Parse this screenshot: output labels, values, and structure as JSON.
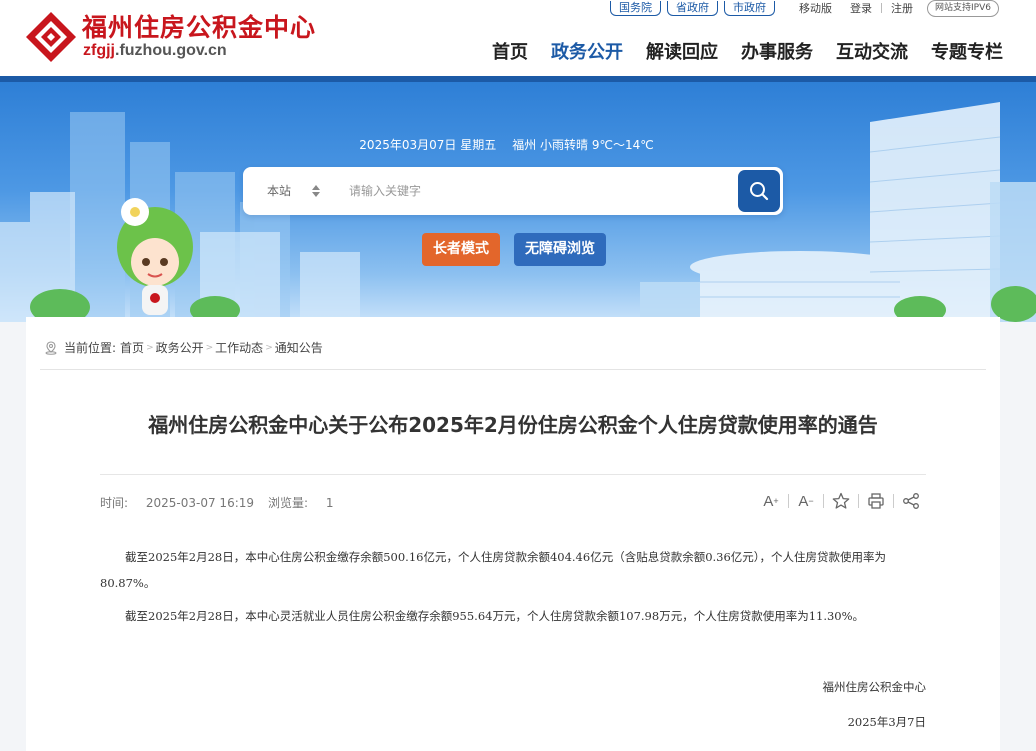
{
  "header": {
    "site_title": "福州住房公积金中心",
    "domain_prefix": "zfgjj",
    "domain_suffix": ".fuzhou.gov.cn",
    "gov_links": [
      "国务院",
      "省政府",
      "市政府"
    ],
    "mobile_label": "移动版",
    "login_label": "登录",
    "register_label": "注册",
    "ipv6_label": "网站支持IPV6",
    "nav": [
      "首页",
      "政务公开",
      "解读回应",
      "办事服务",
      "互动交流",
      "专题专栏"
    ],
    "active_nav": "政务公开"
  },
  "banner": {
    "date": "2025年03月07日 星期五",
    "weather": "福州 小雨转晴 9℃～14℃",
    "search_scope": "本站",
    "search_placeholder": "请输入关键字",
    "elder_mode_label": "长者模式",
    "accessible_label": "无障碍浏览"
  },
  "breadcrumb": {
    "prefix": "当前位置:",
    "items": [
      "首页",
      "政务公开",
      "工作动态",
      "通知公告"
    ]
  },
  "article": {
    "title": "福州住房公积金中心关于公布2025年2月份住房公积金个人住房贷款使用率的通告",
    "time_label": "时间:",
    "time": "2025-03-07 16:19",
    "views_label": "浏览量:",
    "views": "1",
    "paragraphs": [
      "截至2025年2月28日，本中心住房公积金缴存余额500.16亿元，个人住房贷款余额404.46亿元（含贴息贷款余额0.36亿元），个人住房贷款使用率为80.87%。",
      "截至2025年2月28日，本中心灵活就业人员住房公积金缴存余额955.64万元，个人住房贷款余额107.98万元，个人住房贷款使用率为11.30%。"
    ],
    "signature": "福州住房公积金中心",
    "sign_date": "2025年3月7日"
  },
  "colors": {
    "brand_red": "#c8161d",
    "brand_blue": "#1c5aa6",
    "elder_orange": "#e3662b"
  },
  "icons": [
    "logo-mark",
    "search-icon",
    "location-icon",
    "font-increase-icon",
    "font-decrease-icon",
    "star-icon",
    "print-icon",
    "share-icon"
  ]
}
